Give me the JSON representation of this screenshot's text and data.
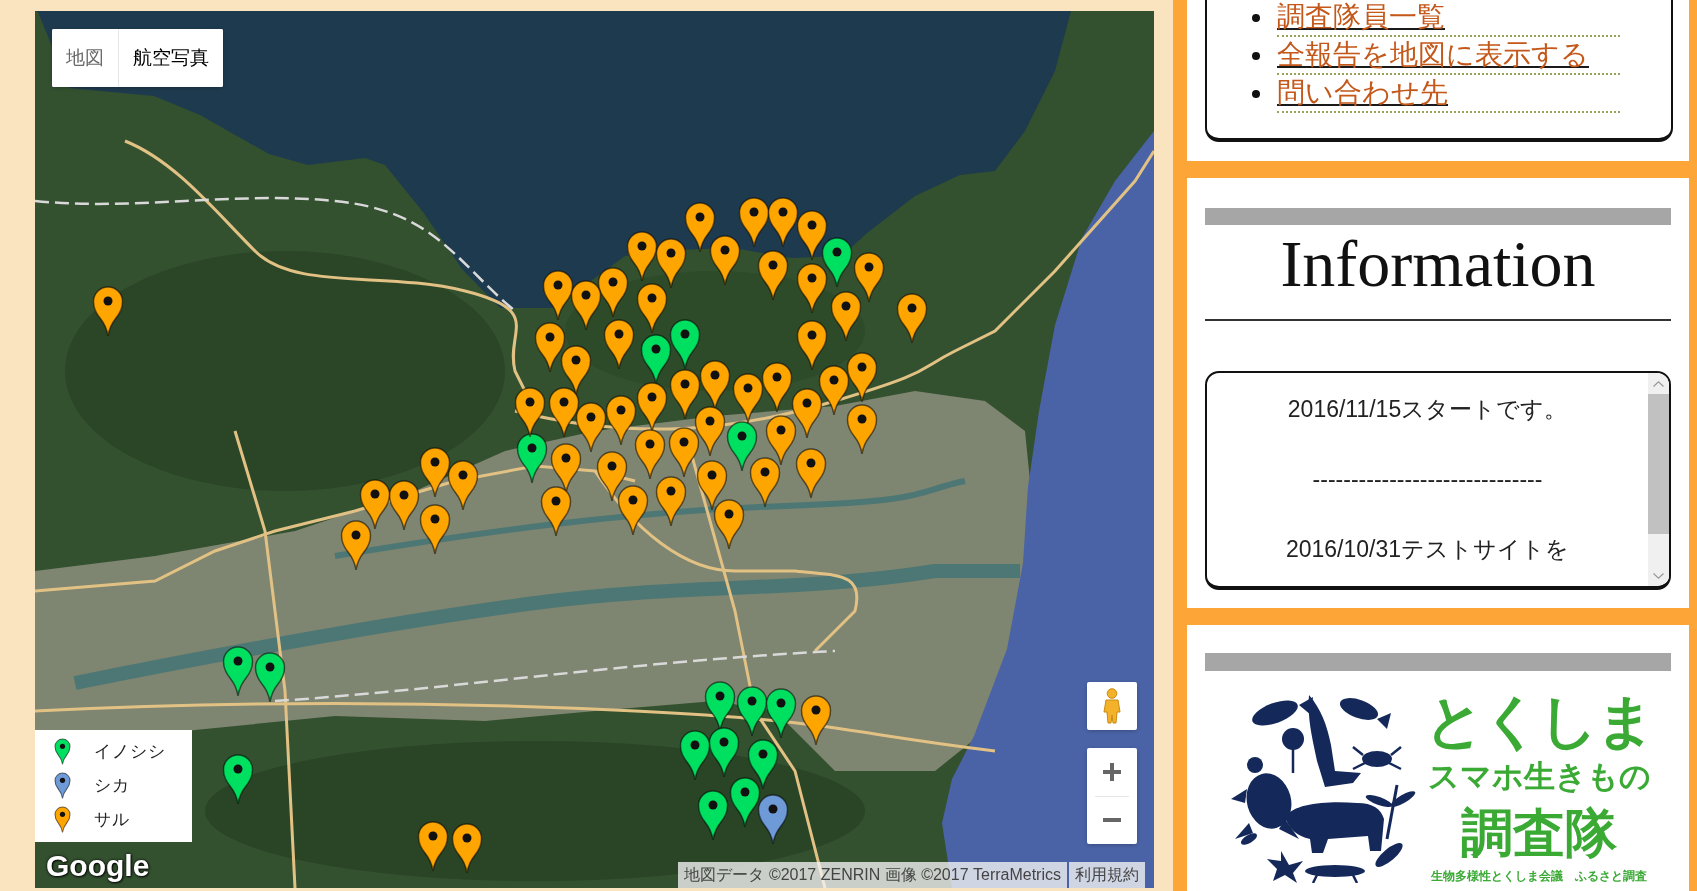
{
  "map": {
    "map_type_buttons": [
      {
        "label": "地図",
        "selected": false
      },
      {
        "label": "航空写真",
        "selected": true
      }
    ],
    "markers": [
      {
        "color": "#ffa500"
      },
      {
        "color": "#ffa500"
      },
      {
        "color": "#ffa500"
      },
      {
        "color": "#ffa500"
      },
      {
        "color": "#ffa500"
      },
      {
        "color": "#ffa500"
      },
      {
        "color": "#ffa500"
      },
      {
        "color": "#ffa500"
      },
      {
        "color": "#00e060"
      },
      {
        "color": "#ffa500"
      },
      {
        "color": "#ffa500"
      },
      {
        "color": "#ffa500"
      },
      {
        "color": "#ffa500"
      },
      {
        "color": "#ffa500"
      },
      {
        "color": "#ffa500"
      },
      {
        "color": "#ffa500"
      },
      {
        "color": "#ffa500"
      },
      {
        "color": "#ffa500"
      },
      {
        "color": "#ffa500"
      },
      {
        "color": "#00e060"
      },
      {
        "color": "#ffa500"
      },
      {
        "color": "#00e060"
      },
      {
        "color": "#ffa500"
      },
      {
        "color": "#ffa500"
      },
      {
        "color": "#ffa500"
      },
      {
        "color": "#ffa500"
      },
      {
        "color": "#ffa500"
      },
      {
        "color": "#ffa500"
      },
      {
        "color": "#ffa500"
      },
      {
        "color": "#ffa500"
      },
      {
        "color": "#ffa500"
      },
      {
        "color": "#ffa500"
      },
      {
        "color": "#ffa500"
      },
      {
        "color": "#ffa500"
      },
      {
        "color": "#ffa500"
      },
      {
        "color": "#ffa500"
      },
      {
        "color": "#ffa500"
      },
      {
        "color": "#00e060"
      },
      {
        "color": "#ffa500"
      },
      {
        "color": "#ffa500"
      },
      {
        "color": "#ffa500"
      },
      {
        "color": "#ffa500"
      },
      {
        "color": "#ffa500"
      },
      {
        "color": "#ffa500"
      },
      {
        "color": "#ffa500"
      },
      {
        "color": "#ffa500"
      },
      {
        "color": "#ffa500"
      },
      {
        "color": "#ffa500"
      },
      {
        "color": "#00e060"
      },
      {
        "color": "#ffa500"
      },
      {
        "color": "#ffa500"
      },
      {
        "color": "#ffa500"
      },
      {
        "color": "#ffa500"
      },
      {
        "color": "#ffa500"
      },
      {
        "color": "#ffa500"
      },
      {
        "color": "#ffa500"
      },
      {
        "color": "#ffa500"
      },
      {
        "color": "#ffa500"
      },
      {
        "color": "#00e060"
      },
      {
        "color": "#00e060"
      },
      {
        "color": "#00e060"
      },
      {
        "color": "#00e060"
      },
      {
        "color": "#00e060"
      },
      {
        "color": "#00e060"
      },
      {
        "color": "#00e060"
      },
      {
        "color": "#ffa500"
      },
      {
        "color": "#00e060"
      },
      {
        "color": "#00e060"
      },
      {
        "color": "#00e060"
      },
      {
        "color": "#6e9ad8"
      },
      {
        "color": "#00e060"
      },
      {
        "color": "#ffa500"
      },
      {
        "color": "#ffa500"
      }
    ],
    "legend": [
      {
        "label": "イノシシ",
        "color": "#00e060"
      },
      {
        "label": "シカ",
        "color": "#6e9ad8"
      },
      {
        "label": "サル",
        "color": "#ffa500"
      }
    ],
    "logo": "Google",
    "attribution": {
      "text": "地図データ ©2017 ZENRIN 画像 ©2017 TerraMetrics",
      "terms_link": "利用規約"
    }
  },
  "sidebar": {
    "nav_links": [
      "調査隊員一覧",
      "全報告を地図に表示する",
      "問い合わせ先"
    ],
    "information": {
      "title": "Information",
      "notices": [
        "2016/11/15スタートです。",
        "------------------------------",
        "2016/10/31テストサイトを"
      ]
    },
    "logo_panel": {
      "title": "とくしま",
      "subtitle": "スマホ生きもの",
      "name": "調査隊",
      "organizer": "生物多様性とくしま会議　ふるさと調査"
    }
  }
}
